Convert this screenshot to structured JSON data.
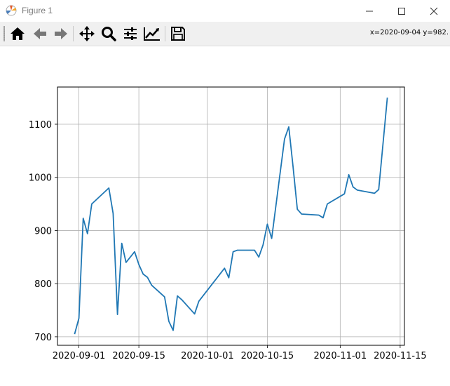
{
  "window": {
    "title": "Figure 1",
    "controls": {
      "minimize": "—",
      "maximize": "☐",
      "close": "✕"
    }
  },
  "toolbar": {
    "buttons": [
      {
        "name": "home-icon",
        "tooltip": "Home"
      },
      {
        "name": "back-arrow-icon",
        "tooltip": "Back"
      },
      {
        "name": "forward-arrow-icon",
        "tooltip": "Forward"
      },
      {
        "name": "pan-icon",
        "tooltip": "Pan"
      },
      {
        "name": "zoom-icon",
        "tooltip": "Zoom"
      },
      {
        "name": "subplots-icon",
        "tooltip": "Subplots"
      },
      {
        "name": "edit-axis-icon",
        "tooltip": "Customize"
      },
      {
        "name": "save-icon",
        "tooltip": "Save"
      }
    ],
    "coordinates": "x=2020-09-04 y=982."
  },
  "colors": {
    "line": "#1f77b4",
    "grid": "#b0b0b0",
    "toolbar_bg": "#f0f0f0"
  },
  "chart_data": {
    "type": "line",
    "title": "",
    "xlabel": "",
    "ylabel": "",
    "grid": true,
    "xlim": [
      "2020-08-27",
      "2020-11-16"
    ],
    "ylim": [
      684,
      1170
    ],
    "x_ticks": [
      "2020-09-01",
      "2020-09-15",
      "2020-10-01",
      "2020-10-15",
      "2020-11-01",
      "2020-11-15"
    ],
    "y_ticks": [
      700,
      800,
      900,
      1000,
      1100
    ],
    "series": [
      {
        "x": [
          "2020-08-31",
          "2020-09-01",
          "2020-09-02",
          "2020-09-03",
          "2020-09-04",
          "2020-09-08",
          "2020-09-09",
          "2020-09-10",
          "2020-09-11",
          "2020-09-12",
          "2020-09-14",
          "2020-09-15",
          "2020-09-16",
          "2020-09-17",
          "2020-09-18",
          "2020-09-21",
          "2020-09-22",
          "2020-09-23",
          "2020-09-24",
          "2020-09-25",
          "2020-09-28",
          "2020-09-29",
          "2020-10-05",
          "2020-10-06",
          "2020-10-07",
          "2020-10-08",
          "2020-10-12",
          "2020-10-13",
          "2020-10-14",
          "2020-10-15",
          "2020-10-16",
          "2020-10-19",
          "2020-10-20",
          "2020-10-21",
          "2020-10-22",
          "2020-10-23",
          "2020-10-27",
          "2020-10-28",
          "2020-10-29",
          "2020-11-02",
          "2020-11-03",
          "2020-11-04",
          "2020-11-05",
          "2020-11-09",
          "2020-11-10",
          "2020-11-12"
        ],
        "y": [
          705,
          735,
          923,
          894,
          950,
          980,
          932,
          742,
          876,
          840,
          860,
          836,
          818,
          812,
          797,
          775,
          729,
          712,
          777,
          770,
          743,
          767,
          829,
          811,
          860,
          863,
          863,
          850,
          873,
          912,
          885,
          1072,
          1095,
          1020,
          940,
          931,
          929,
          924,
          950,
          969,
          1005,
          982,
          976,
          970,
          977,
          1150
        ]
      }
    ]
  }
}
